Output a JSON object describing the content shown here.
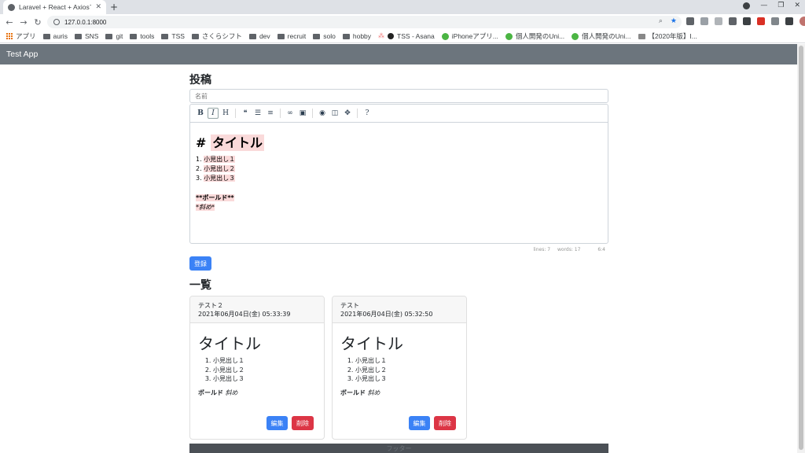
{
  "browser": {
    "tab_title": "Laravel + React + Axiosで",
    "url": "127.0.0.1:8000",
    "bookmarks": [
      {
        "label": "アプリ",
        "icon": "apps-grid-icon"
      },
      {
        "label": "auris",
        "icon": "folder-icon"
      },
      {
        "label": "SNS",
        "icon": "folder-icon"
      },
      {
        "label": "git",
        "icon": "folder-icon"
      },
      {
        "label": "tools",
        "icon": "folder-icon"
      },
      {
        "label": "TSS",
        "icon": "folder-icon"
      },
      {
        "label": "さくらシフト",
        "icon": "folder-icon"
      },
      {
        "label": "dev",
        "icon": "folder-icon"
      },
      {
        "label": "recruit",
        "icon": "folder-icon"
      },
      {
        "label": "solo",
        "icon": "folder-icon"
      },
      {
        "label": "hobby",
        "icon": "folder-icon"
      },
      {
        "label": "TSS - Asana",
        "icon": "asana-icon"
      },
      {
        "label": "iPhoneアプリ...",
        "icon": "site-icon"
      },
      {
        "label": "個人開発のUni...",
        "icon": "site-icon"
      },
      {
        "label": "個人開発のUni...",
        "icon": "site-icon"
      },
      {
        "label": "【2020年版】I...",
        "icon": "site-icon"
      }
    ]
  },
  "app": {
    "brand": "Test App",
    "post_heading": "投稿",
    "name_placeholder": "名前",
    "editor": {
      "heading_prefix": "# ",
      "heading_text": "タイトル",
      "list_items": [
        {
          "num": "1. ",
          "text": "小見出し１"
        },
        {
          "num": "2. ",
          "text": "小見出し２"
        },
        {
          "num": "3. ",
          "text": "小見出し３"
        }
      ],
      "bold_line": "**ボールド**",
      "italic_line": "*斜め*",
      "status": {
        "lines": "lines: 7",
        "words": "words: 17",
        "cursor": "6:4"
      }
    },
    "submit_label": "登録",
    "list_heading": "一覧",
    "posts": [
      {
        "name": "テスト２",
        "date": "2021年06月04日(金) 05:33:39",
        "title": "タイトル",
        "items": [
          "小見出し１",
          "小見出し２",
          "小見出し３"
        ],
        "bold": "ボールド",
        "italic": "斜め",
        "edit_label": "編集",
        "delete_label": "削除"
      },
      {
        "name": "テスト",
        "date": "2021年06月04日(金) 05:32:50",
        "title": "タイトル",
        "items": [
          "小見出し１",
          "小見出し２",
          "小見出し３"
        ],
        "bold": "ボールド",
        "italic": "斜め",
        "edit_label": "編集",
        "delete_label": "削除"
      }
    ],
    "footer_text": "フッター"
  },
  "colors": {
    "navbar": "#6c757d",
    "primary": "#3b82f6",
    "danger": "#dc3545",
    "highlight": "#fadada"
  }
}
